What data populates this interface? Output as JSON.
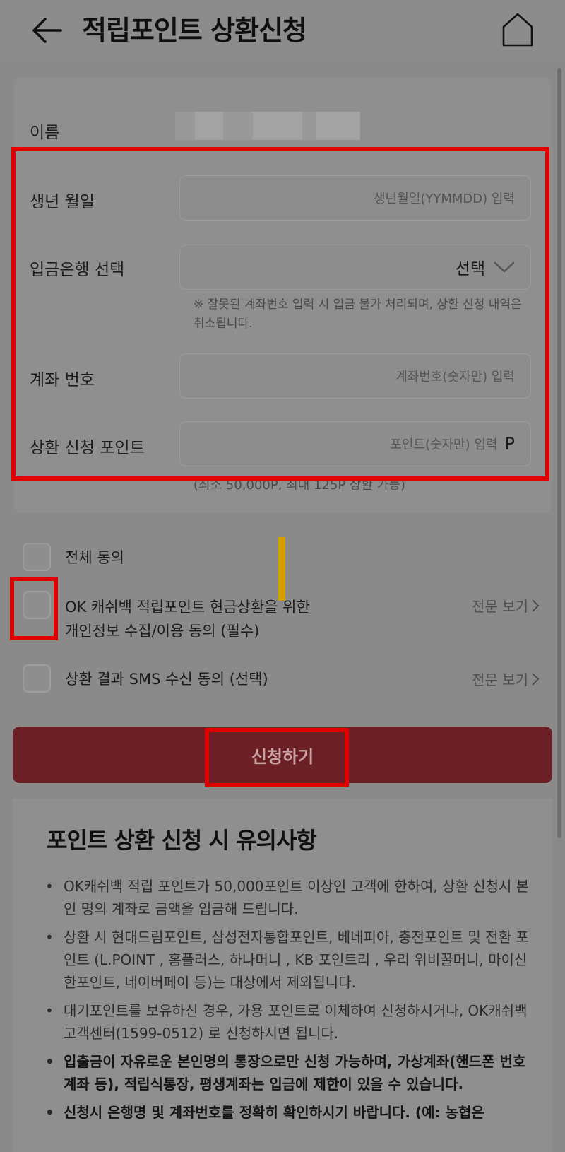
{
  "header": {
    "title": "적립포인트 상환신청"
  },
  "form": {
    "name_label": "이름",
    "birth_label": "생년 월일",
    "birth_placeholder": "생년월일(YYMMDD) 입력",
    "bank_label": "입금은행 선택",
    "bank_value": "선택",
    "bank_note": "※ 잘못된 계좌번호 입력 시 입금 불가 처리되며, 상환 신청 내역은 취소됩니다.",
    "account_label": "계좌 번호",
    "account_placeholder": "계좌번호(숫자만) 입력",
    "points_label": "상환 신청 포인트",
    "points_placeholder": "포인트(숫자만) 입력",
    "points_suffix": "P",
    "points_note": "(최소 50,000P, 최대 125P 상환 가능)"
  },
  "agreements": {
    "all_label": "전체 동의",
    "privacy_label": "OK 캐쉬백 적립포인트 현금상환을 위한\n개인정보 수집/이용 동의 (필수)",
    "sms_label": "상환 결과 SMS 수신 동의 (선택)",
    "view_label": "전문 보기"
  },
  "submit_label": "신청하기",
  "notice": {
    "title": "포인트 상환 신청 시 유의사항",
    "items": [
      "OK캐쉬백 적립 포인트가 50,000포인트 이상인 고객에 한하여, 상환 신청시 본인 명의 계좌로 금액을 입금해 드립니다.",
      "상환 시 현대드림포인트, 삼성전자통합포인트, 베네피아, 충전포인트 및 전환 포인트 (L.POINT , 홈플러스, 하나머니 , KB 포인트리 , 우리 위비꿀머니, 마이신한포인트, 네이버페이 등)는 대상에서 제외됩니다.",
      "대기포인트를 보유하신 경우, 가용 포인트로 이체하여 신청하시거나, OK캐쉬백 고객센터(1599-0512) 로 신청하시면 됩니다.",
      "입출금이 자유로운 본인명의 통장으로만 신청 가능하며, 가상계좌(핸드폰 번호 계좌 등), 적립식통장, 평생계좌는 입금에 제한이 있을 수 있습니다.",
      "신청시 은행명 및 계좌번호를 정확히 확인하시기 바랍니다. (예: 농협은"
    ]
  },
  "colors": {
    "highlight": "#e00000",
    "submit": "#6a2024",
    "marker": "#d4a000"
  }
}
